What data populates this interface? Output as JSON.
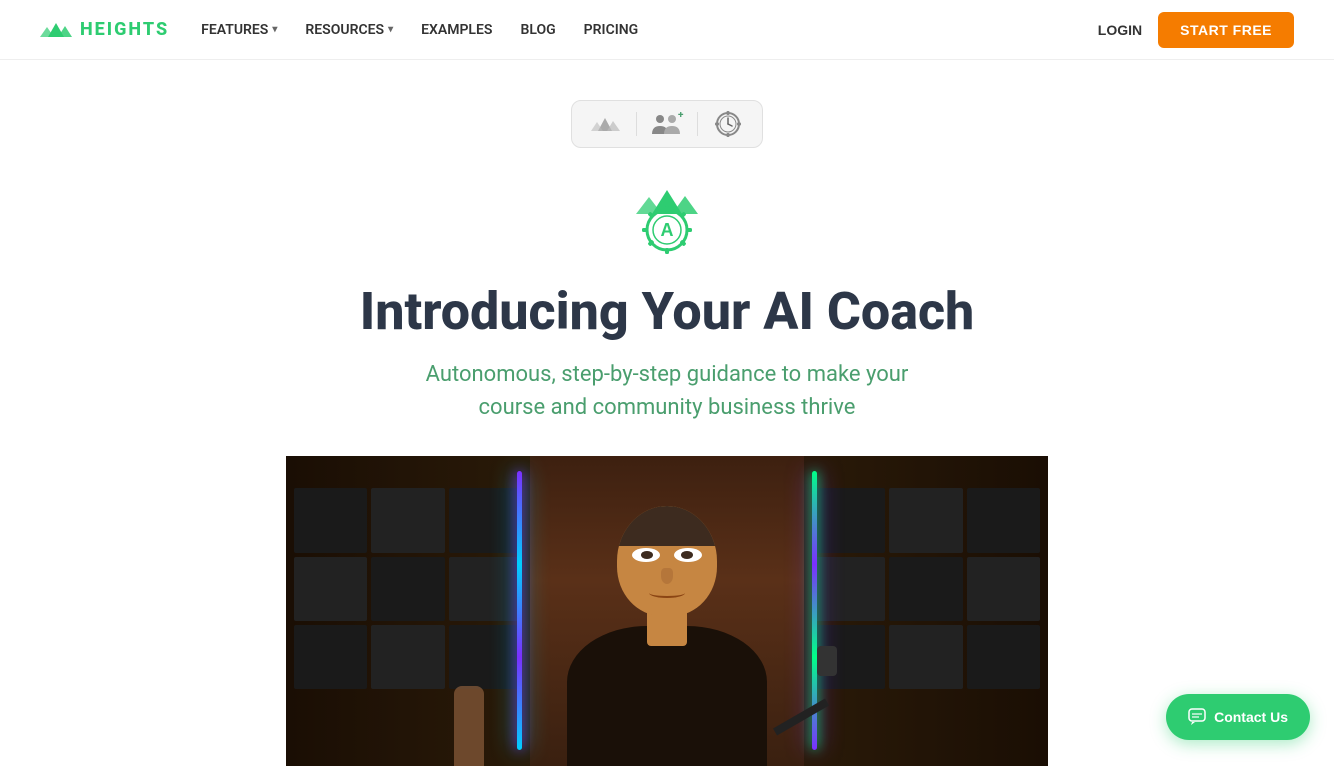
{
  "navbar": {
    "logo_text": "HEIGHTS",
    "nav_items": [
      {
        "label": "FEATURES",
        "has_dropdown": true
      },
      {
        "label": "RESOURCES",
        "has_dropdown": true
      },
      {
        "label": "EXAMPLES",
        "has_dropdown": false
      },
      {
        "label": "BLOG",
        "has_dropdown": false
      },
      {
        "label": "PRICING",
        "has_dropdown": false
      }
    ],
    "login_label": "LOGIN",
    "start_free_label": "START FREE"
  },
  "hero": {
    "title": "Introducing Your AI Coach",
    "subtitle_line1": "Autonomous, step-by-step guidance to make your",
    "subtitle_line2": "course and community business thrive"
  },
  "contact": {
    "label": "Contact Us"
  }
}
